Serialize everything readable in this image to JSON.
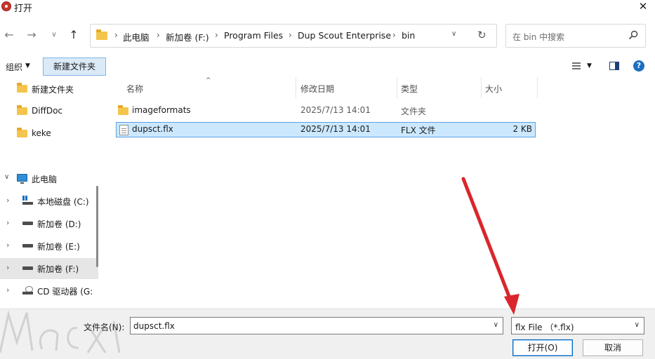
{
  "window": {
    "title": "打开",
    "close_glyph": "✕"
  },
  "address_bar": {
    "crumbs": [
      "此电脑",
      "新加卷 (F:)",
      "Program Files",
      "Dup Scout Enterprise",
      "bin"
    ],
    "separator": "›"
  },
  "search": {
    "placeholder": "在 bin 中搜索"
  },
  "toolbar": {
    "organize_label": "组织",
    "new_folder_label": "新建文件夹"
  },
  "nav_pane": {
    "quick_access": [
      {
        "label": "新建文件夹"
      },
      {
        "label": "DiffDoc"
      },
      {
        "label": "keke"
      }
    ],
    "this_pc": "此电脑",
    "drives": [
      {
        "label": "本地磁盘 (C:)"
      },
      {
        "label": "新加卷 (D:)"
      },
      {
        "label": "新加卷 (E:)"
      },
      {
        "label": "新加卷 (F:)"
      },
      {
        "label": "CD 驱动器 (G:"
      }
    ]
  },
  "file_list": {
    "columns": [
      "名称",
      "修改日期",
      "类型",
      "大小"
    ],
    "rows": [
      {
        "name": "imageformats",
        "modified": "2025/7/13 14:01",
        "type": "文件夹",
        "size": ""
      },
      {
        "name": "dupsct.flx",
        "modified": "2025/7/13 14:01",
        "type": "FLX 文件",
        "size": "2 KB"
      }
    ]
  },
  "footer": {
    "filename_label": "文件名(N):",
    "filename_value": "dupsct.flx",
    "filter_value": "flx File （*.flx)",
    "open_label": "打开(O)",
    "cancel_label": "取消"
  },
  "annotation": {
    "arrow_color": "#d9262c"
  }
}
